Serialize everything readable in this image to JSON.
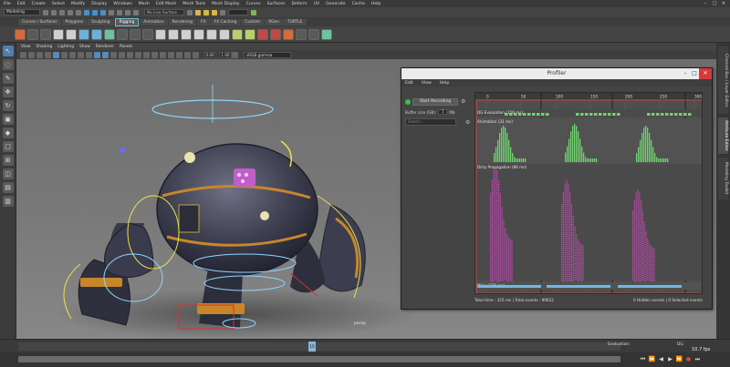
{
  "menubar": {
    "items": [
      "File",
      "Edit",
      "Create",
      "Select",
      "Modify",
      "Display",
      "Windows",
      "Mesh",
      "Edit Mesh",
      "Mesh Tools",
      "Mesh Display",
      "Curves",
      "Surfaces",
      "Deform",
      "UV",
      "Generate",
      "Cache",
      "Help"
    ]
  },
  "statusline": {
    "mode": "Modeling",
    "live_surface": "No Live Surface"
  },
  "shelf": {
    "tabs": [
      "Curves / Surfaces",
      "Polygons",
      "Sculpting",
      "Rigging",
      "Animation",
      "Rendering",
      "FX",
      "FX Caching",
      "Custom",
      "XGen",
      "TURTLE"
    ],
    "active_tab": "Rigging"
  },
  "viewport": {
    "menu": [
      "View",
      "Shading",
      "Lighting",
      "Show",
      "Renderer",
      "Panels"
    ],
    "near_value": "0.00",
    "far_value": "1.00",
    "color_space": "sRGB gamma",
    "camera_label": "persp"
  },
  "right_tabs": [
    "Channel Box / Layer Editor",
    "Attribute Editor",
    "Modeling Toolkit"
  ],
  "profiler": {
    "title": "Profiler",
    "menu": [
      "Edit",
      "View",
      "Help"
    ],
    "record_label": "Start Recording",
    "buffer_label": "Buffer size (GB):",
    "buffer_value": "1",
    "buffer_unit": "Mb",
    "search_placeholder": "Search...",
    "ruler_ticks": [
      "0",
      "50",
      "100",
      "150",
      "200",
      "250",
      "300"
    ],
    "track_labels": [
      "DG Evaluation (156 ms)",
      "Animation (31 ms)",
      "Dirty Propagation (86 ms)",
      "Main (326 ms)"
    ],
    "status_left": "Total time : 325 ms | Total events : 99622",
    "status_right": "0 Hidden events | 0 Selected events",
    "colors": {
      "eval": "#6fd36f",
      "dirty": "#d64fc8",
      "main": "#6fb8e8",
      "cursor": "#d94040"
    }
  },
  "timeline": {
    "current_frame": "15",
    "evaluation_label": "Evaluation:",
    "evaluation_mode": "DG",
    "fps": "10.7 fps"
  }
}
